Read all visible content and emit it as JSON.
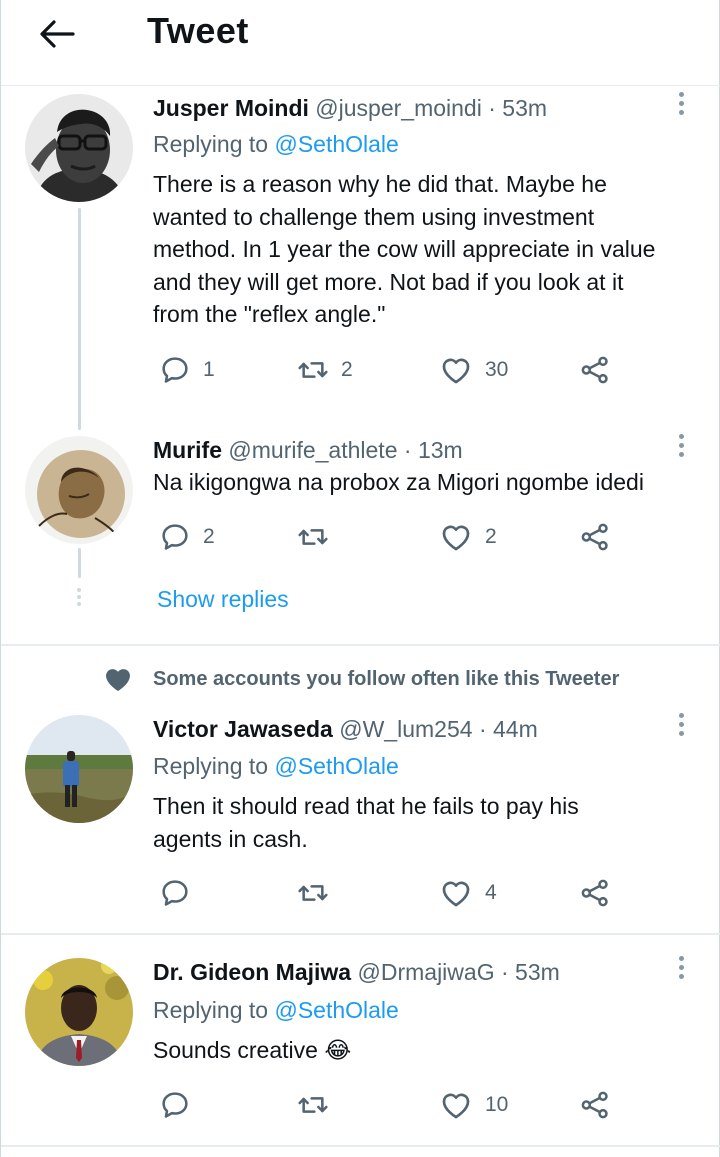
{
  "header": {
    "title": "Tweet",
    "back_icon": "arrow-left-icon"
  },
  "colors": {
    "accent": "#1d9bf0",
    "muted": "#536471",
    "border": "#cfd9de",
    "text": "#0f1419"
  },
  "thread": [
    {
      "name": "Jusper Moindi",
      "handle": "@jusper_moindi",
      "sep": "·",
      "time": "53m",
      "replying_label": "Replying to",
      "replying_to": "@SethOlale",
      "text": "There is a reason why he did that. Maybe he\nwanted to challenge them using investment\nmethod. In 1 year the cow will appreciate in value\nand they will get more. Not bad if you look at it\nfrom the \"reflex angle.\"",
      "replies": "1",
      "retweets": "2",
      "likes": "30"
    },
    {
      "name": "Murife",
      "handle": "@murife_athlete",
      "sep": "·",
      "time": "13m",
      "text": "Na ikigongwa na probox za Migori ngombe idedi",
      "replies": "2",
      "retweets": "",
      "likes": "2"
    }
  ],
  "show_replies": "Show replies",
  "social_context": "Some accounts you follow often like this Tweeter",
  "replies": [
    {
      "name": "Victor Jawaseda",
      "handle": "@W_lum254",
      "sep": "·",
      "time": "44m",
      "replying_label": "Replying to",
      "replying_to": "@SethOlale",
      "text": "Then it should read that he fails to pay his\nagents in cash.",
      "replies": "",
      "retweets": "",
      "likes": "4"
    },
    {
      "name": "Dr. Gideon Majiwa",
      "handle": "@DrmajiwaG",
      "sep": "·",
      "time": "53m",
      "replying_label": "Replying to",
      "replying_to": "@SethOlale",
      "text": "Sounds creative 😂",
      "replies": "",
      "retweets": "",
      "likes": "10"
    }
  ],
  "icons": {
    "reply": "reply-icon",
    "retweet": "retweet-icon",
    "like": "heart-icon",
    "share": "share-icon",
    "more": "more-vertical-icon",
    "social": "heart-filled-icon"
  }
}
